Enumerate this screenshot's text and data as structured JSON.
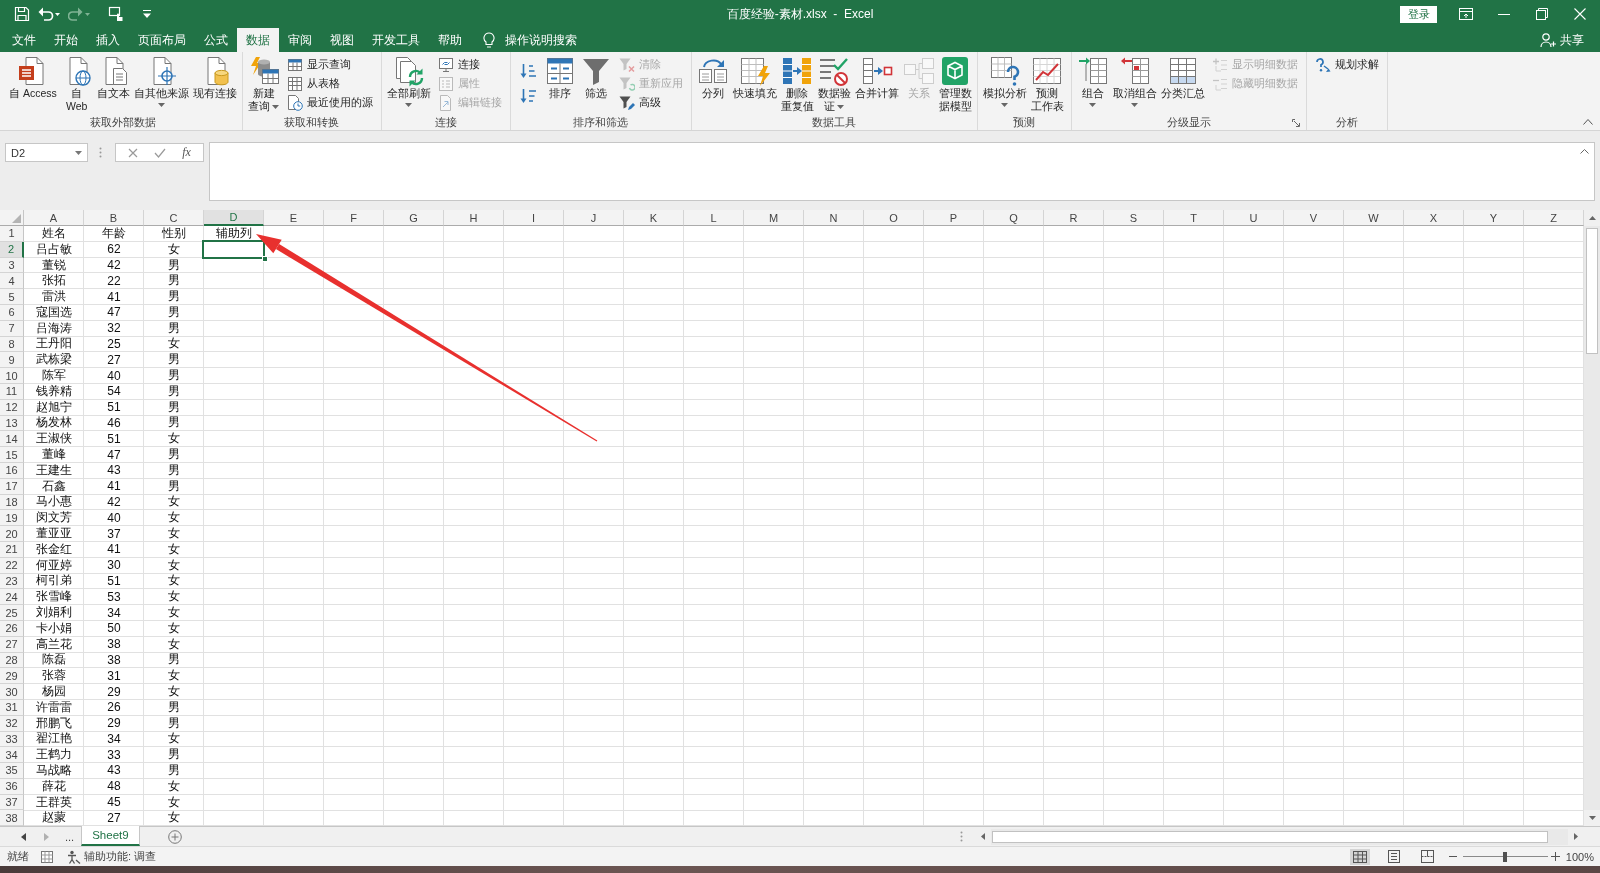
{
  "title_bar": {
    "title": "百度经验-素材.xlsx  -  Excel",
    "sign_in": "登录"
  },
  "tabs": [
    {
      "label": "文件",
      "selected": false
    },
    {
      "label": "开始",
      "selected": false
    },
    {
      "label": "插入",
      "selected": false
    },
    {
      "label": "页面布局",
      "selected": false
    },
    {
      "label": "公式",
      "selected": false
    },
    {
      "label": "数据",
      "selected": true
    },
    {
      "label": "审阅",
      "selected": false
    },
    {
      "label": "视图",
      "selected": false
    },
    {
      "label": "开发工具",
      "selected": false
    },
    {
      "label": "帮助",
      "selected": false
    }
  ],
  "tell_me": "操作说明搜索",
  "share": "共享",
  "ribbon": {
    "groups": [
      {
        "label": "获取外部数据",
        "launcher": false,
        "items": [
          {
            "kind": "large",
            "lines": [
              "自 Access"
            ],
            "dropdown": false,
            "disabled": false
          },
          {
            "kind": "large",
            "lines": [
              "自",
              "Web"
            ],
            "dropdown": false,
            "disabled": false
          },
          {
            "kind": "large",
            "lines": [
              "自文本"
            ],
            "dropdown": false,
            "disabled": false
          },
          {
            "kind": "large",
            "lines": [
              "自其他来源"
            ],
            "dropdown": true,
            "disabled": false
          },
          {
            "kind": "large",
            "lines": [
              "现有连接"
            ],
            "dropdown": false,
            "disabled": false
          }
        ]
      },
      {
        "label": "获取和转换",
        "launcher": false,
        "items": [
          {
            "kind": "large",
            "lines": [
              "新建",
              "查询"
            ],
            "dropdown": true,
            "disabled": false
          },
          {
            "kind": "stack",
            "items": [
              {
                "label": "显示查询",
                "disabled": false
              },
              {
                "label": "从表格",
                "disabled": false
              },
              {
                "label": "最近使用的源",
                "disabled": false
              }
            ]
          }
        ]
      },
      {
        "label": "连接",
        "launcher": false,
        "items": [
          {
            "kind": "large",
            "lines": [
              "全部刷新"
            ],
            "dropdown": true,
            "disabled": false
          },
          {
            "kind": "stack",
            "items": [
              {
                "label": "连接",
                "disabled": false
              },
              {
                "label": "属性",
                "disabled": true
              },
              {
                "label": "编辑链接",
                "disabled": true
              }
            ]
          }
        ]
      },
      {
        "label": "排序和筛选",
        "launcher": false,
        "items": [
          {
            "kind": "icons",
            "items": [
              {
                "disabled": false
              },
              {
                "disabled": false
              }
            ]
          },
          {
            "kind": "large",
            "lines": [
              "排序"
            ],
            "dropdown": false,
            "disabled": false
          },
          {
            "kind": "large",
            "lines": [
              "筛选"
            ],
            "dropdown": false,
            "disabled": false
          },
          {
            "kind": "stack",
            "items": [
              {
                "label": "清除",
                "disabled": true
              },
              {
                "label": "重新应用",
                "disabled": true
              },
              {
                "label": "高级",
                "disabled": false
              }
            ]
          }
        ]
      },
      {
        "label": "数据工具",
        "launcher": false,
        "items": [
          {
            "kind": "large",
            "lines": [
              "分列"
            ],
            "dropdown": false,
            "disabled": false
          },
          {
            "kind": "large",
            "lines": [
              "快速填充"
            ],
            "dropdown": false,
            "disabled": false
          },
          {
            "kind": "large",
            "lines": [
              "删除",
              "重复值"
            ],
            "dropdown": false,
            "disabled": false
          },
          {
            "kind": "large",
            "lines": [
              "数据验",
              "证"
            ],
            "dropdown": true,
            "disabled": false
          },
          {
            "kind": "large",
            "lines": [
              "合并计算"
            ],
            "dropdown": false,
            "disabled": false
          },
          {
            "kind": "large",
            "lines": [
              "关系"
            ],
            "dropdown": false,
            "disabled": true
          },
          {
            "kind": "large",
            "lines": [
              "管理数",
              "据模型"
            ],
            "dropdown": false,
            "disabled": false
          }
        ]
      },
      {
        "label": "预测",
        "launcher": false,
        "items": [
          {
            "kind": "large",
            "lines": [
              "模拟分析"
            ],
            "dropdown": true,
            "disabled": false
          },
          {
            "kind": "large",
            "lines": [
              "预测",
              "工作表"
            ],
            "dropdown": false,
            "disabled": false
          }
        ]
      },
      {
        "label": "分级显示",
        "launcher": true,
        "items": [
          {
            "kind": "large",
            "lines": [
              "组合"
            ],
            "dropdown": true,
            "disabled": false
          },
          {
            "kind": "large",
            "lines": [
              "取消组合"
            ],
            "dropdown": true,
            "disabled": false
          },
          {
            "kind": "large",
            "lines": [
              "分类汇总"
            ],
            "dropdown": false,
            "disabled": false
          },
          {
            "kind": "stack",
            "items": [
              {
                "label": "显示明细数据",
                "disabled": true
              },
              {
                "label": "隐藏明细数据",
                "disabled": true
              }
            ]
          }
        ]
      },
      {
        "label": "分析",
        "launcher": false,
        "items": [
          {
            "kind": "stack",
            "items": [
              {
                "label": "规划求解",
                "disabled": false
              }
            ]
          }
        ]
      }
    ]
  },
  "formula_bar": {
    "name_box": "D2",
    "function_button": "fx"
  },
  "sheet": {
    "columns": [
      {
        "label": "A",
        "selected": false
      },
      {
        "label": "B",
        "selected": false
      },
      {
        "label": "C",
        "selected": false
      },
      {
        "label": "D",
        "selected": true
      },
      {
        "label": "E",
        "selected": false
      },
      {
        "label": "F",
        "selected": false
      },
      {
        "label": "G",
        "selected": false
      },
      {
        "label": "H",
        "selected": false
      },
      {
        "label": "I",
        "selected": false
      },
      {
        "label": "J",
        "selected": false
      },
      {
        "label": "K",
        "selected": false
      },
      {
        "label": "L",
        "selected": false
      },
      {
        "label": "M",
        "selected": false
      },
      {
        "label": "N",
        "selected": false
      },
      {
        "label": "O",
        "selected": false
      },
      {
        "label": "P",
        "selected": false
      },
      {
        "label": "Q",
        "selected": false
      },
      {
        "label": "R",
        "selected": false
      },
      {
        "label": "S",
        "selected": false
      },
      {
        "label": "T",
        "selected": false
      },
      {
        "label": "U",
        "selected": false
      },
      {
        "label": "V",
        "selected": false
      },
      {
        "label": "W",
        "selected": false
      },
      {
        "label": "X",
        "selected": false
      },
      {
        "label": "Y",
        "selected": false
      },
      {
        "label": "Z",
        "selected": false
      }
    ],
    "rows": [
      {
        "number": "1",
        "selected": false,
        "cells": [
          "姓名",
          "年龄",
          "性别",
          "辅助列"
        ]
      },
      {
        "number": "2",
        "selected": true,
        "cells": [
          "吕占敏",
          "62",
          "女"
        ]
      },
      {
        "number": "3",
        "selected": false,
        "cells": [
          "董锐",
          "42",
          "男"
        ]
      },
      {
        "number": "4",
        "selected": false,
        "cells": [
          "张拓",
          "22",
          "男"
        ]
      },
      {
        "number": "5",
        "selected": false,
        "cells": [
          "雷洪",
          "41",
          "男"
        ]
      },
      {
        "number": "6",
        "selected": false,
        "cells": [
          "寇国选",
          "47",
          "男"
        ]
      },
      {
        "number": "7",
        "selected": false,
        "cells": [
          "吕海涛",
          "32",
          "男"
        ]
      },
      {
        "number": "8",
        "selected": false,
        "cells": [
          "王丹阳",
          "25",
          "女"
        ]
      },
      {
        "number": "9",
        "selected": false,
        "cells": [
          "武栋梁",
          "27",
          "男"
        ]
      },
      {
        "number": "10",
        "selected": false,
        "cells": [
          "陈军",
          "40",
          "男"
        ]
      },
      {
        "number": "11",
        "selected": false,
        "cells": [
          "钱养精",
          "54",
          "男"
        ]
      },
      {
        "number": "12",
        "selected": false,
        "cells": [
          "赵旭宁",
          "51",
          "男"
        ]
      },
      {
        "number": "13",
        "selected": false,
        "cells": [
          "杨发林",
          "46",
          "男"
        ]
      },
      {
        "number": "14",
        "selected": false,
        "cells": [
          "王淑侠",
          "51",
          "女"
        ]
      },
      {
        "number": "15",
        "selected": false,
        "cells": [
          "董峰",
          "47",
          "男"
        ]
      },
      {
        "number": "16",
        "selected": false,
        "cells": [
          "王建生",
          "43",
          "男"
        ]
      },
      {
        "number": "17",
        "selected": false,
        "cells": [
          "石鑫",
          "41",
          "男"
        ]
      },
      {
        "number": "18",
        "selected": false,
        "cells": [
          "马小惠",
          "42",
          "女"
        ]
      },
      {
        "number": "19",
        "selected": false,
        "cells": [
          "闵文芳",
          "40",
          "女"
        ]
      },
      {
        "number": "20",
        "selected": false,
        "cells": [
          "董亚亚",
          "37",
          "女"
        ]
      },
      {
        "number": "21",
        "selected": false,
        "cells": [
          "张金红",
          "41",
          "女"
        ]
      },
      {
        "number": "22",
        "selected": false,
        "cells": [
          "何亚婷",
          "30",
          "女"
        ]
      },
      {
        "number": "23",
        "selected": false,
        "cells": [
          "柯引弟",
          "51",
          "女"
        ]
      },
      {
        "number": "24",
        "selected": false,
        "cells": [
          "张雪峰",
          "53",
          "女"
        ]
      },
      {
        "number": "25",
        "selected": false,
        "cells": [
          "刘娟利",
          "34",
          "女"
        ]
      },
      {
        "number": "26",
        "selected": false,
        "cells": [
          "卡小娟",
          "50",
          "女"
        ]
      },
      {
        "number": "27",
        "selected": false,
        "cells": [
          "高兰花",
          "38",
          "女"
        ]
      },
      {
        "number": "28",
        "selected": false,
        "cells": [
          "陈磊",
          "38",
          "男"
        ]
      },
      {
        "number": "29",
        "selected": false,
        "cells": [
          "张蓉",
          "31",
          "女"
        ]
      },
      {
        "number": "30",
        "selected": false,
        "cells": [
          "杨园",
          "29",
          "女"
        ]
      },
      {
        "number": "31",
        "selected": false,
        "cells": [
          "许雷雷",
          "26",
          "男"
        ]
      },
      {
        "number": "32",
        "selected": false,
        "cells": [
          "邢鹏飞",
          "29",
          "男"
        ]
      },
      {
        "number": "33",
        "selected": false,
        "cells": [
          "翟江艳",
          "34",
          "女"
        ]
      },
      {
        "number": "34",
        "selected": false,
        "cells": [
          "王鹤力",
          "33",
          "男"
        ]
      },
      {
        "number": "35",
        "selected": false,
        "cells": [
          "马战略",
          "43",
          "男"
        ]
      },
      {
        "number": "36",
        "selected": false,
        "cells": [
          "薛花",
          "48",
          "女"
        ]
      },
      {
        "number": "37",
        "selected": false,
        "cells": [
          "王群英",
          "45",
          "女"
        ]
      },
      {
        "number": "38",
        "selected": false,
        "cells": [
          "赵蒙",
          "27",
          "女"
        ]
      }
    ]
  },
  "sheet_tabs": {
    "more": "...",
    "tabs": [
      {
        "label": "Sheet9",
        "selected": true
      }
    ]
  },
  "status_bar": {
    "mode": "就绪",
    "accessibility": "辅助功能: 调查",
    "views": [
      {
        "selected": true
      },
      {
        "selected": false
      },
      {
        "selected": false
      }
    ],
    "zoom": {
      "level": 0.5,
      "reading": "100%"
    }
  }
}
